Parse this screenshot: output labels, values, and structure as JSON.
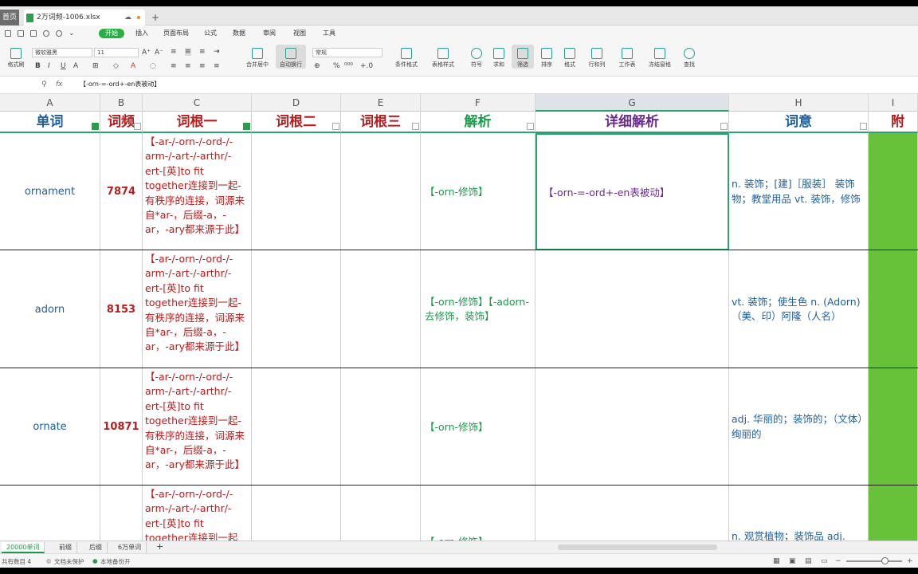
{
  "tabs": {
    "home": "首页",
    "file": "2万词频-1006.xlsx"
  },
  "menu": {
    "items": [
      "开始",
      "插入",
      "页面布局",
      "公式",
      "数据",
      "审阅",
      "视图",
      "工具"
    ]
  },
  "ribbon": {
    "format_painter": "格式刷",
    "font_name": "微软雅黑",
    "font_size": "11",
    "bold": "B",
    "italic": "I",
    "underline": "U",
    "merge_center": "合并居中",
    "wrap_text": "自动换行",
    "number_format": "常规",
    "conditional_format": "条件格式",
    "table_style": "表格样式",
    "symbol": "符号",
    "sum": "求和",
    "filter": "筛选",
    "sort": "排序",
    "format": "格式",
    "row_col": "行和列",
    "worksheet": "工作表",
    "freeze": "冻结窗格",
    "find": "查找"
  },
  "formula": {
    "content": "【-orn-=-ord+-en表被动】"
  },
  "columns": [
    "A",
    "B",
    "C",
    "D",
    "E",
    "F",
    "G",
    "H",
    "I"
  ],
  "headers": {
    "a": "单词",
    "b": "词频",
    "c": "词根一",
    "d": "词根二",
    "e": "词根三",
    "f": "解析",
    "g": "详细解析",
    "h": "词意",
    "i": "附件"
  },
  "rows": [
    {
      "word": "ornament",
      "freq": "7874",
      "root1": "【-ar-/-orn-/-ord-/-arm-/-art-/-arthr/-ert-[英]to fit together连接到一起-有秩序的连接，词源来自*ar-，后缀-a，-ar，-ary都来源于此】",
      "analysis": "【-orn-修饰】",
      "detail": "【-orn-=-ord+-en表被动】",
      "meaning": "n. 装饰；[建]［服装］ 装饰物；教堂用品 vt. 装饰，修饰"
    },
    {
      "word": "adorn",
      "freq": "8153",
      "root1": "【-ar-/-orn-/-ord-/-arm-/-art-/-arthr/-ert-[英]to fit together连接到一起-有秩序的连接，词源来自*ar-，后缀-a，-ar，-ary都来源于此】",
      "analysis": "【-orn-修饰】【-adorn-去修饰，装饰】",
      "detail": "",
      "meaning": "vt. 装饰；使生色 n. (Adorn) （美、印）阿隆（人名）"
    },
    {
      "word": "ornate",
      "freq": "10871",
      "root1": "【-ar-/-orn-/-ord-/-arm-/-art-/-arthr/-ert-[英]to fit together连接到一起-有秩序的连接，词源来自*ar-，后缀-a，-ar，-ary都来源于此】",
      "analysis": "【-orn-修饰】",
      "detail": "",
      "meaning": "adj. 华丽的；装饰的；（文体）绚丽的"
    },
    {
      "word": "",
      "freq": "",
      "root1": "【-ar-/-orn-/-ord-/-arm-/-art-/-arthr/-ert-[英]to fit together连接到一起",
      "analysis": "【-orn-修饰】",
      "detail": "",
      "meaning": "n. 观赏植物；装饰品 adj."
    }
  ],
  "sheets": [
    "20000单词",
    "前缀",
    "后缀",
    "6万单词"
  ],
  "status": {
    "count": "共有数目 4",
    "protect": "文档未保护",
    "backup": "本地备份开"
  }
}
